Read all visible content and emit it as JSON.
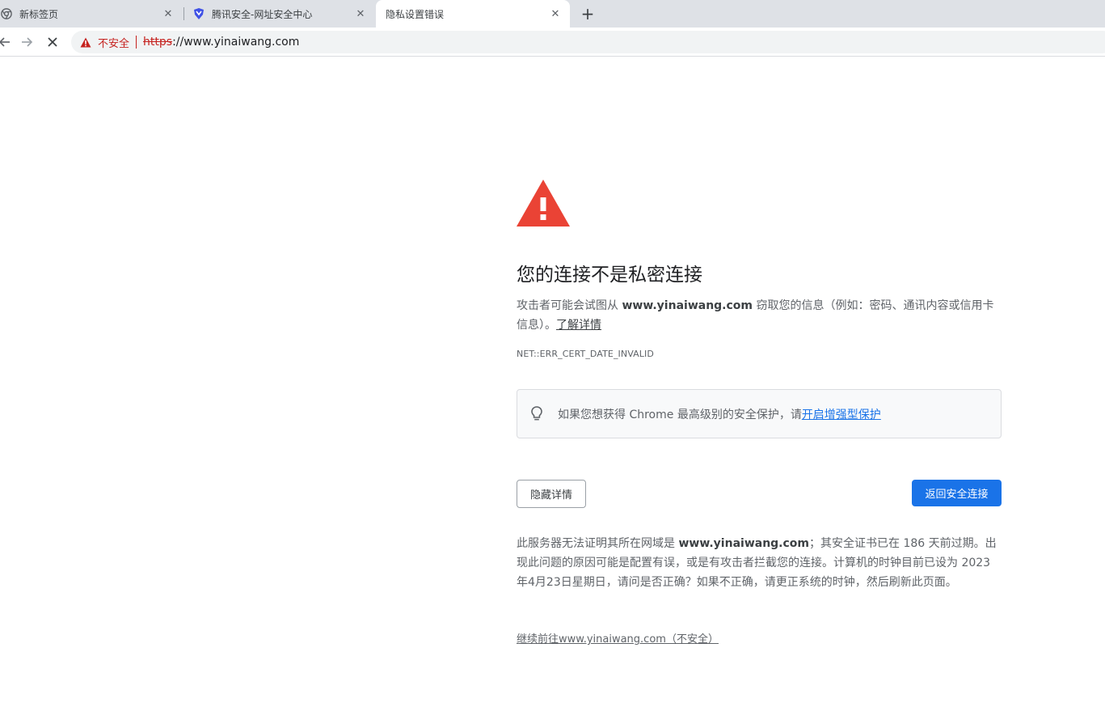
{
  "tabs": [
    {
      "title": "新标签页",
      "icon": "chrome-icon"
    },
    {
      "title": "腾讯安全-网址安全中心",
      "icon": "tencent-shield-icon"
    },
    {
      "title": "隐私设置错误",
      "icon": ""
    }
  ],
  "omnibox": {
    "security_label": "不安全",
    "url_scheme": "https",
    "url_rest": "://www.yinaiwang.com"
  },
  "page": {
    "heading": "您的连接不是私密连接",
    "explain_pre": "攻击者可能会试图从 ",
    "explain_host": "www.yinaiwang.com",
    "explain_post": " 窃取您的信息（例如：密码、通讯内容或信用卡信息）。",
    "learn_more": "了解详情",
    "error_code": "NET::ERR_CERT_DATE_INVALID",
    "enhanced_text": "如果您想获得 Chrome 最高级别的安全保护，请",
    "enhanced_link": "开启增强型保护",
    "hide_details_button": "隐藏详情",
    "back_button": "返回安全连接",
    "details_pre": "此服务器无法证明其所在网域是 ",
    "details_host": "www.yinaiwang.com",
    "details_post": "；其安全证书已在 186 天前过期。出现此问题的原因可能是配置有误，或是有攻击者拦截您的连接。计算机的时钟目前已设为 2023年4月23日星期日，请问是否正确？如果不正确，请更正系统的时钟，然后刷新此页面。",
    "proceed_link": "继续前往www.yinaiwang.com（不安全）"
  },
  "colors": {
    "warning_red": "#ea4335",
    "not_secure_red": "#c5221f",
    "primary_blue": "#1a73e8"
  }
}
